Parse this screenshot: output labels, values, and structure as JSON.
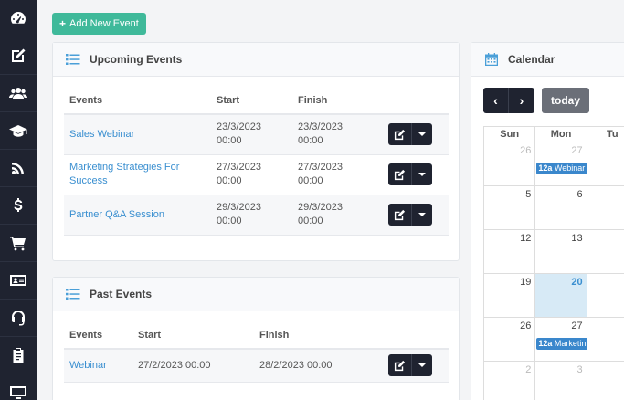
{
  "sidebar": {
    "items": [
      {
        "icon": "dashboard-icon"
      },
      {
        "icon": "edit-icon"
      },
      {
        "icon": "users-icon"
      },
      {
        "icon": "graduation-cap-icon"
      },
      {
        "icon": "rss-icon"
      },
      {
        "icon": "dollar-icon"
      },
      {
        "icon": "cart-icon"
      },
      {
        "icon": "id-card-icon"
      },
      {
        "icon": "headset-icon"
      },
      {
        "icon": "clipboard-icon"
      },
      {
        "icon": "monitor-icon"
      }
    ]
  },
  "toolbar": {
    "add_label": "Add New Event",
    "add_symbol": "+"
  },
  "upcoming": {
    "title": "Upcoming Events",
    "columns": {
      "events": "Events",
      "start": "Start",
      "finish": "Finish"
    },
    "rows": [
      {
        "name": "Sales Webinar",
        "start_date": "23/3/2023",
        "start_time": "00:00",
        "finish_date": "23/3/2023",
        "finish_time": "00:00"
      },
      {
        "name": "Marketing Strategies For Success",
        "start_date": "27/3/2023",
        "start_time": "00:00",
        "finish_date": "27/3/2023",
        "finish_time": "00:00"
      },
      {
        "name": "Partner Q&A Session",
        "start_date": "29/3/2023",
        "start_time": "00:00",
        "finish_date": "29/3/2023",
        "finish_time": "00:00"
      }
    ]
  },
  "past": {
    "title": "Past Events",
    "columns": {
      "events": "Events",
      "start": "Start",
      "finish": "Finish"
    },
    "rows": [
      {
        "name": "Webinar",
        "start": "27/2/2023 00:00",
        "finish": "28/2/2023 00:00"
      }
    ]
  },
  "calendar": {
    "title": "Calendar",
    "prev": "‹",
    "next": "›",
    "today_label": "today",
    "day_headers": [
      "Sun",
      "Mon",
      "Tu"
    ],
    "weeks": [
      [
        {
          "num": "26",
          "other": true
        },
        {
          "num": "27",
          "other": true,
          "event_time": "12a",
          "event_title": "Webinar"
        },
        {
          "num": ""
        }
      ],
      [
        {
          "num": "5"
        },
        {
          "num": "6"
        },
        {
          "num": ""
        }
      ],
      [
        {
          "num": "12"
        },
        {
          "num": "13"
        },
        {
          "num": ""
        }
      ],
      [
        {
          "num": "19"
        },
        {
          "num": "20",
          "today": true
        },
        {
          "num": ""
        }
      ],
      [
        {
          "num": "26"
        },
        {
          "num": "27",
          "event_time": "12a",
          "event_title": "Marketin"
        },
        {
          "num": ""
        }
      ],
      [
        {
          "num": "2",
          "other": true
        },
        {
          "num": "3",
          "other": true
        },
        {
          "num": ""
        }
      ]
    ]
  }
}
